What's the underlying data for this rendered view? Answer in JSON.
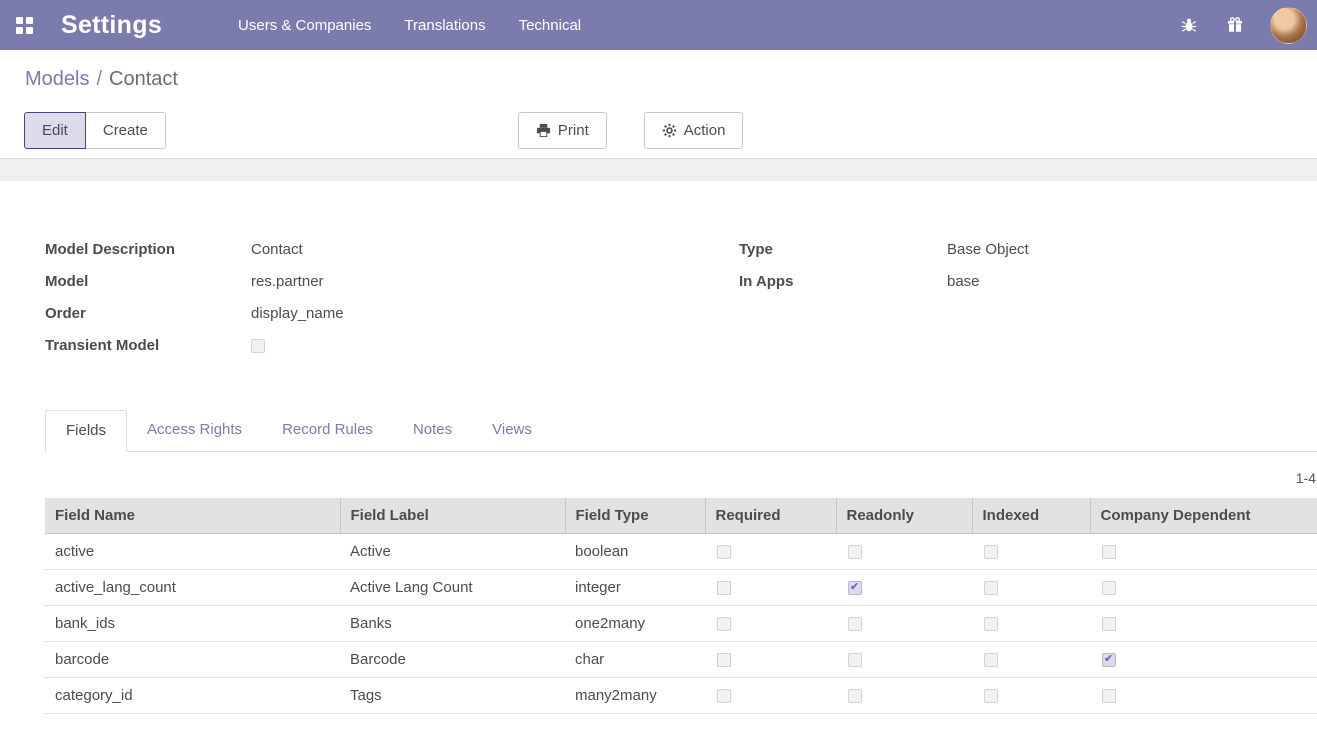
{
  "navbar": {
    "app_title": "Settings",
    "menu_items": [
      "Users & Companies",
      "Translations",
      "Technical"
    ],
    "icons": {
      "apps": "grid-icon",
      "debug": "bug-icon",
      "promo": "gift-icon",
      "user": "avatar"
    }
  },
  "breadcrumb": {
    "parent": "Models",
    "separator": "/",
    "current": "Contact"
  },
  "toolbar": {
    "edit_label": "Edit",
    "create_label": "Create",
    "print_label": "Print",
    "action_label": "Action"
  },
  "form": {
    "left_fields": [
      {
        "label": "Model Description",
        "value": "Contact",
        "type": "text"
      },
      {
        "label": "Model",
        "value": "res.partner",
        "type": "text"
      },
      {
        "label": "Order",
        "value": "display_name",
        "type": "text"
      },
      {
        "label": "Transient Model",
        "value": false,
        "type": "checkbox"
      }
    ],
    "right_fields": [
      {
        "label": "Type",
        "value": "Base Object",
        "type": "text"
      },
      {
        "label": "In Apps",
        "value": "base",
        "type": "text"
      }
    ]
  },
  "tabs": [
    {
      "label": "Fields",
      "active": true
    },
    {
      "label": "Access Rights",
      "active": false
    },
    {
      "label": "Record Rules",
      "active": false
    },
    {
      "label": "Notes",
      "active": false
    },
    {
      "label": "Views",
      "active": false
    }
  ],
  "pager": {
    "text": "1-4"
  },
  "table": {
    "headers": [
      "Field Name",
      "Field Label",
      "Field Type",
      "Required",
      "Readonly",
      "Indexed",
      "Company Dependent"
    ],
    "rows": [
      {
        "field_name": "active",
        "field_label": "Active",
        "field_type": "boolean",
        "flags": [
          false,
          false,
          false,
          false
        ]
      },
      {
        "field_name": "active_lang_count",
        "field_label": "Active Lang Count",
        "field_type": "integer",
        "flags": [
          false,
          true,
          false,
          false
        ]
      },
      {
        "field_name": "bank_ids",
        "field_label": "Banks",
        "field_type": "one2many",
        "flags": [
          false,
          false,
          false,
          false
        ]
      },
      {
        "field_name": "barcode",
        "field_label": "Barcode",
        "field_type": "char",
        "flags": [
          false,
          false,
          false,
          true
        ]
      },
      {
        "field_name": "category_id",
        "field_label": "Tags",
        "field_type": "many2many",
        "flags": [
          false,
          false,
          false,
          false
        ]
      }
    ]
  },
  "colors": {
    "navbar_bg": "#7c7bad",
    "link": "#7c7bad",
    "text": "#4c4c4c",
    "table_header_bg": "#e2e2e2",
    "checkbox_check": "#5f5fad"
  }
}
